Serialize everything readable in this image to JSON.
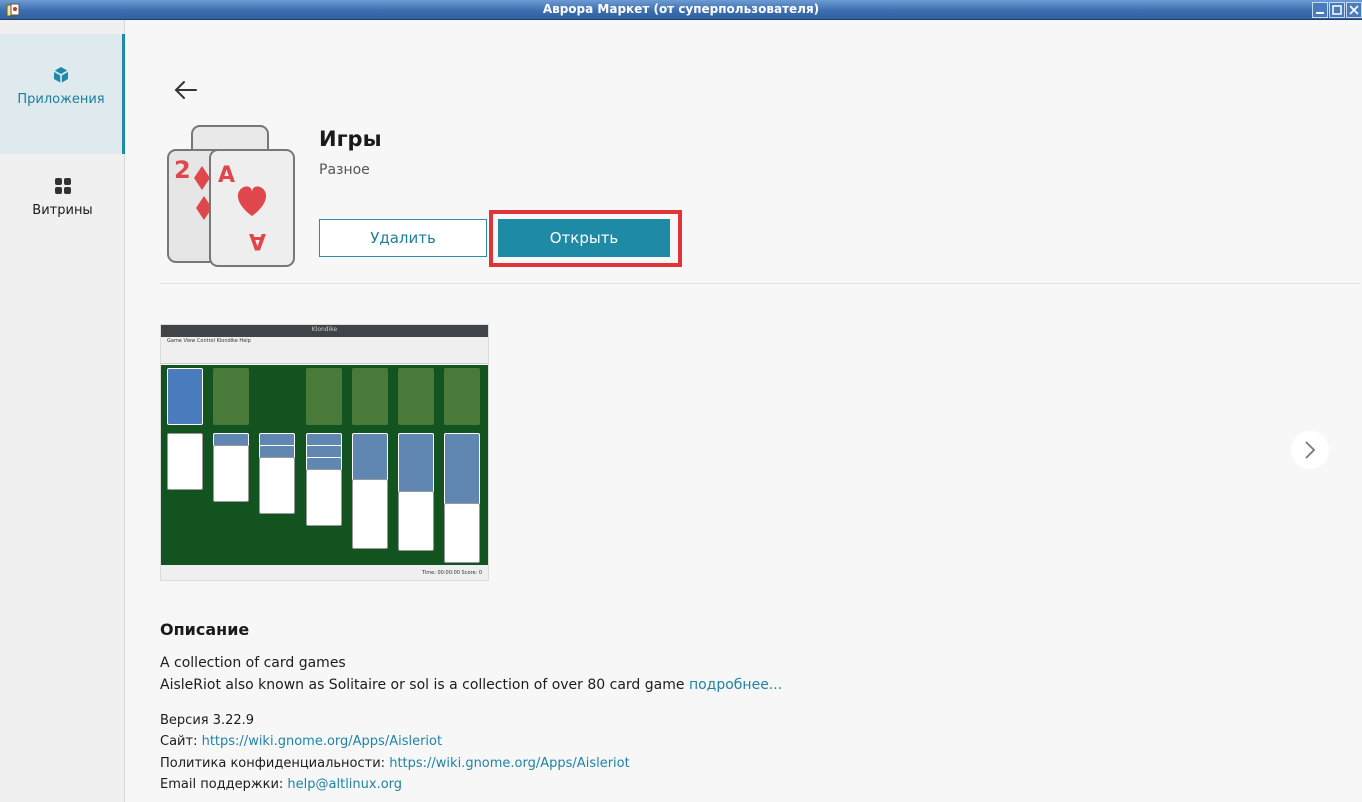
{
  "window": {
    "title": "Аврора Маркет (от суперпользователя)"
  },
  "sidebar": {
    "items": [
      {
        "label": "Приложения",
        "icon": "box-icon",
        "active": true
      },
      {
        "label": "Витрины",
        "icon": "grid-icon",
        "active": false
      }
    ]
  },
  "app": {
    "name": "Игры",
    "category": "Разное",
    "remove_label": "Удалить",
    "open_label": "Открыть"
  },
  "screenshot": {
    "window_title": "Klondike",
    "menu": "Game  View  Control  Klondike  Help",
    "status": "Time:  00:00:00    Score:   0"
  },
  "description": {
    "heading": "Описание",
    "line1": "A collection of card games",
    "line2": "AisleRiot also known as Solitaire or sol is a collection of over 80 card game ",
    "more": "подробнее..."
  },
  "meta": {
    "version": "Версия 3.22.9",
    "site_label": "Сайт:",
    "site_url": "https://wiki.gnome.org/Apps/Aisleriot",
    "privacy_label": "Политика конфиденциальности:",
    "privacy_url": "https://wiki.gnome.org/Apps/Aisleriot",
    "email_label": "Email поддержки:",
    "email": "help@altlinux.org"
  },
  "colors": {
    "accent": "#1f8aa6",
    "highlight": "#e0343b",
    "titlebar": "#3d6fb0"
  }
}
